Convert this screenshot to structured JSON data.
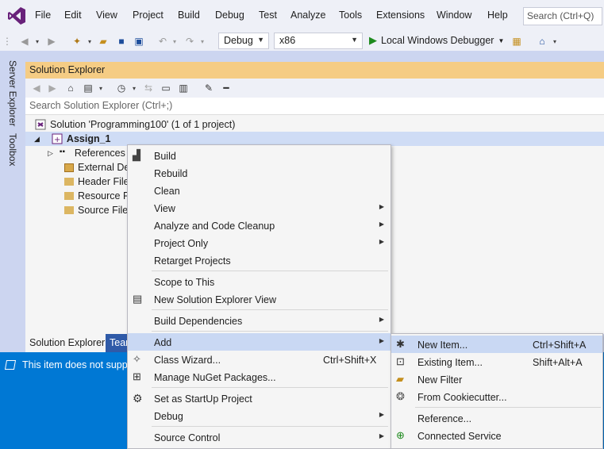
{
  "menubar": {
    "items": [
      "File",
      "Edit",
      "View",
      "Project",
      "Build",
      "Debug",
      "Test",
      "Analyze",
      "Tools",
      "Extensions",
      "Window",
      "Help"
    ],
    "search_placeholder": "Search (Ctrl+Q)"
  },
  "toolbar": {
    "config": "Debug",
    "platform": "x86",
    "run_label": "Local Windows Debugger"
  },
  "side_tabs": [
    "Server Explorer",
    "Toolbox"
  ],
  "solution_explorer": {
    "title": "Solution Explorer",
    "search_placeholder": "Search Solution Explorer (Ctrl+;)",
    "solution_label": "Solution 'Programming100' (1 of 1 project)",
    "project_label": "Assign_1",
    "children": [
      "References",
      "External De",
      "Header File",
      "Resource F",
      "Source File"
    ]
  },
  "bottom_tabs": [
    "Solution Explorer",
    "Team"
  ],
  "info_bar": "This item does not suppo",
  "context_menu": {
    "items": [
      {
        "label": "Build",
        "icon": "build-icon"
      },
      {
        "label": "Rebuild"
      },
      {
        "label": "Clean"
      },
      {
        "label": "View",
        "submenu": true
      },
      {
        "label": "Analyze and Code Cleanup",
        "submenu": true
      },
      {
        "label": "Project Only",
        "submenu": true
      },
      {
        "label": "Retarget Projects"
      },
      {
        "label": "Scope to This"
      },
      {
        "label": "New Solution Explorer View",
        "icon": "new-view-icon"
      },
      {
        "label": "Build Dependencies",
        "submenu": true
      },
      {
        "label": "Add",
        "submenu": true
      },
      {
        "label": "Class Wizard...",
        "shortcut": "Ctrl+Shift+X",
        "icon": "class-wizard-icon"
      },
      {
        "label": "Manage NuGet Packages...",
        "icon": "nuget-icon"
      },
      {
        "label": "Set as StartUp Project",
        "icon": "gear-icon"
      },
      {
        "label": "Debug",
        "submenu": true
      },
      {
        "label": "Source Control",
        "submenu": true
      }
    ]
  },
  "add_submenu": {
    "items": [
      {
        "label": "New Item...",
        "shortcut": "Ctrl+Shift+A",
        "icon": "new-item-icon"
      },
      {
        "label": "Existing Item...",
        "shortcut": "Shift+Alt+A",
        "icon": "existing-item-icon"
      },
      {
        "label": "New Filter",
        "icon": "new-filter-icon"
      },
      {
        "label": "From Cookiecutter...",
        "icon": "cookiecutter-icon"
      },
      {
        "label": "Reference..."
      },
      {
        "label": "Connected Service",
        "icon": "connected-service-icon"
      }
    ]
  },
  "colors": {
    "accent": "#0078d4",
    "header": "#f5cc84",
    "highlight": "#c9d8f3",
    "vs_purple": "#68217a"
  }
}
